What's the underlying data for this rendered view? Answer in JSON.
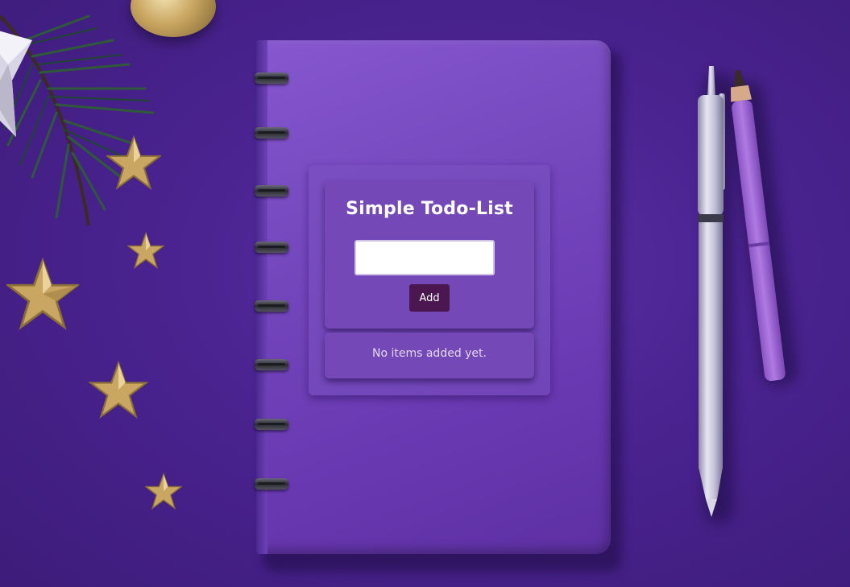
{
  "app": {
    "title": "Simple Todo-List",
    "input": {
      "value": "",
      "placeholder": ""
    },
    "add_button_label": "Add",
    "empty_message": "No items added yet."
  },
  "colors": {
    "background": "#4a2390",
    "notebook": "#7548be",
    "card": "#7548b8",
    "add_button": "#4a1750",
    "title_text": "#ffffff"
  }
}
